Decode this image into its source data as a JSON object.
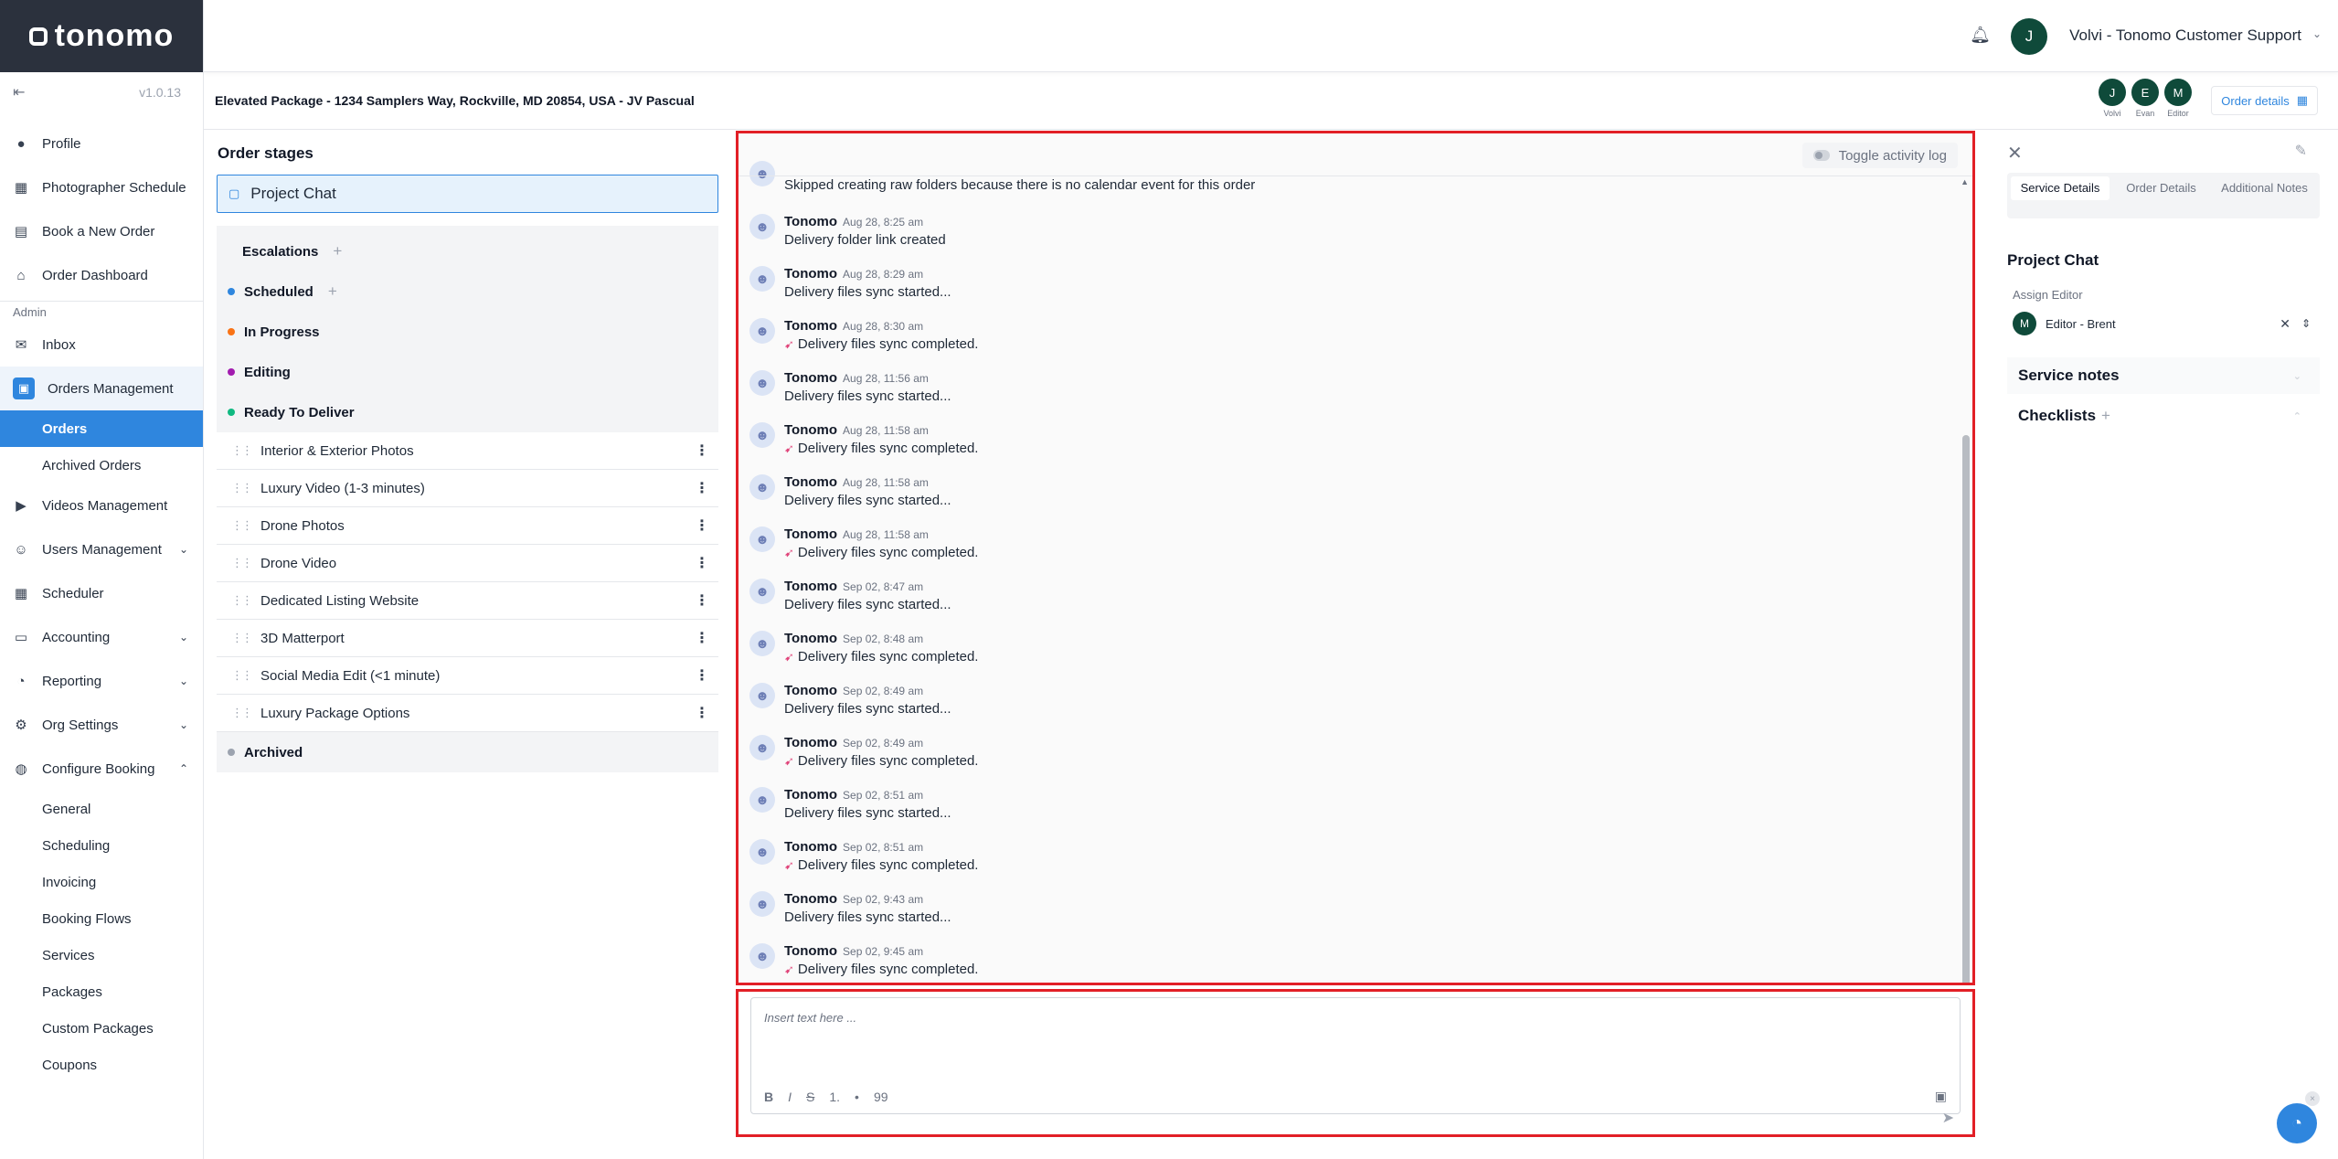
{
  "app": {
    "logo_text": "tonomo",
    "version": "v1.0.13"
  },
  "header": {
    "user_initial": "J",
    "user_name": "Volvi - Tonomo Customer Support"
  },
  "sidebar": {
    "items_top": [
      {
        "label": "Profile",
        "icon": "user-icon"
      },
      {
        "label": "Photographer Schedule",
        "icon": "calendar-icon"
      },
      {
        "label": "Book a New Order",
        "icon": "book-icon"
      },
      {
        "label": "Order Dashboard",
        "icon": "home-icon"
      }
    ],
    "admin_label": "Admin",
    "inbox": "Inbox",
    "orders_management": "Orders Management",
    "orders": "Orders",
    "archived_orders": "Archived Orders",
    "videos_management": "Videos Management",
    "users_management": "Users Management",
    "scheduler": "Scheduler",
    "accounting": "Accounting",
    "reporting": "Reporting",
    "org_settings": "Org Settings",
    "configure_booking": "Configure Booking",
    "config_sub": [
      "General",
      "Scheduling",
      "Invoicing",
      "Booking Flows",
      "Services",
      "Packages",
      "Custom Packages",
      "Coupons"
    ]
  },
  "order": {
    "title": "Elevated Package - 1234 Samplers Way, Rockville, MD 20854, USA - JV Pascual",
    "team": [
      {
        "initial": "J",
        "name": "Volvi"
      },
      {
        "initial": "E",
        "name": "Evan"
      },
      {
        "initial": "M",
        "name": "Editor"
      }
    ],
    "details_button": "Order details"
  },
  "stages": {
    "title": "Order stages",
    "project_chat": "Project Chat",
    "escalations": "Escalations",
    "scheduled": "Scheduled",
    "in_progress": "In Progress",
    "editing": "Editing",
    "ready_to_deliver": "Ready To Deliver",
    "tasks": [
      "Interior & Exterior Photos",
      "Luxury Video (1-3 minutes)",
      "Drone Photos",
      "Drone Video",
      "Dedicated Listing Website",
      "3D Matterport",
      "Social Media Edit (<1 minute)",
      "Luxury Package Options"
    ],
    "archived": "Archived",
    "colors": {
      "scheduled": "#2f86de",
      "in_progress": "#f97316",
      "editing": "#a21caf",
      "ready_to_deliver": "#10b981",
      "archived": "#9ca3af"
    }
  },
  "chat": {
    "toggle_label": "Toggle activity log",
    "first_partial_text": "Skipped creating raw folders because there is no calendar event for this order",
    "messages": [
      {
        "author": "Tonomo",
        "time": "Aug 28, 8:25 am",
        "text": "Delivery folder link created",
        "icon": ""
      },
      {
        "author": "Tonomo",
        "time": "Aug 28, 8:29 am",
        "text": "Delivery files sync started...",
        "icon": ""
      },
      {
        "author": "Tonomo",
        "time": "Aug 28, 8:30 am",
        "text": "Delivery files sync completed.",
        "icon": "sync-icon"
      },
      {
        "author": "Tonomo",
        "time": "Aug 28, 11:56 am",
        "text": "Delivery files sync started...",
        "icon": ""
      },
      {
        "author": "Tonomo",
        "time": "Aug 28, 11:58 am",
        "text": "Delivery files sync completed.",
        "icon": "sync-icon"
      },
      {
        "author": "Tonomo",
        "time": "Aug 28, 11:58 am",
        "text": "Delivery files sync started...",
        "icon": ""
      },
      {
        "author": "Tonomo",
        "time": "Aug 28, 11:58 am",
        "text": "Delivery files sync completed.",
        "icon": "sync-icon"
      },
      {
        "author": "Tonomo",
        "time": "Sep 02, 8:47 am",
        "text": "Delivery files sync started...",
        "icon": ""
      },
      {
        "author": "Tonomo",
        "time": "Sep 02, 8:48 am",
        "text": "Delivery files sync completed.",
        "icon": "sync-icon"
      },
      {
        "author": "Tonomo",
        "time": "Sep 02, 8:49 am",
        "text": "Delivery files sync started...",
        "icon": ""
      },
      {
        "author": "Tonomo",
        "time": "Sep 02, 8:49 am",
        "text": "Delivery files sync completed.",
        "icon": "sync-icon"
      },
      {
        "author": "Tonomo",
        "time": "Sep 02, 8:51 am",
        "text": "Delivery files sync started...",
        "icon": ""
      },
      {
        "author": "Tonomo",
        "time": "Sep 02, 8:51 am",
        "text": "Delivery files sync completed.",
        "icon": "sync-icon"
      },
      {
        "author": "Tonomo",
        "time": "Sep 02, 9:43 am",
        "text": "Delivery files sync started...",
        "icon": ""
      },
      {
        "author": "Tonomo",
        "time": "Sep 02, 9:45 am",
        "text": "Delivery files sync completed.",
        "icon": "sync-icon"
      }
    ],
    "composer_placeholder": "Insert text here ...",
    "format_buttons": [
      "B",
      "I",
      "S",
      "1.",
      "•",
      "99"
    ]
  },
  "right_panel": {
    "tabs": [
      "Service Details",
      "Order Details",
      "Additional Notes"
    ],
    "active_tab": "Service Details",
    "section_title": "Project Chat",
    "assign_label": "Assign Editor",
    "assignee_initial": "M",
    "assignee": "Editor - Brent",
    "service_notes": "Service notes",
    "checklists": "Checklists"
  }
}
